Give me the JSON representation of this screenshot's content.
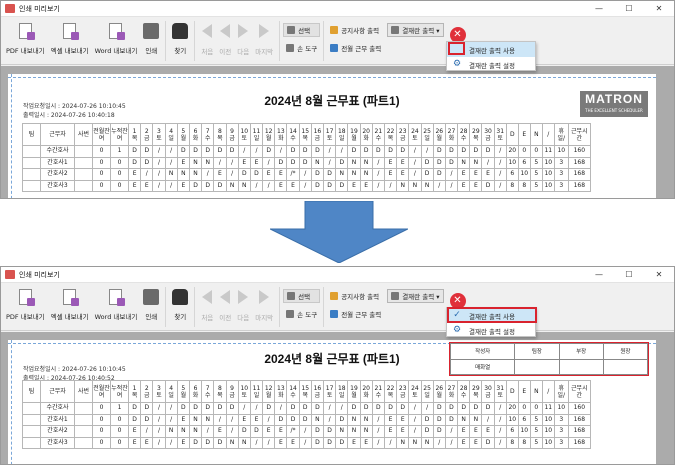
{
  "window": {
    "title": "인쇄 미리보기",
    "controls": [
      "—",
      "☐",
      "✕"
    ]
  },
  "toolbar": {
    "pdf": "PDF 내보내기",
    "excel": "엑셀 내보내기",
    "word": "Word 내보내기",
    "print": "인쇄",
    "find": "찾기",
    "first": "처음",
    "prev": "이전",
    "next": "다음",
    "last": "마지막",
    "select": "선택",
    "hand": "손 도구",
    "notice": "공지사항 출력",
    "full": "전월 근무 출력",
    "approval_dropdown": "결재란 출력 ▾"
  },
  "menu": {
    "use": "결재란 출력 사용",
    "settings": "결재란 출력 설정"
  },
  "doc_top": {
    "created": "작업요청일시 : 2024-07-26 10:10:45",
    "printed": "출력일시 : 2024-07-26 10:40:18"
  },
  "doc_bottom": {
    "created": "작업요청일시 : 2024-07-26 10:10:45",
    "printed": "출력일시 : 2024-07-26 10:40:52"
  },
  "doc_title": "2024년 8월 근무표 (파트1)",
  "logo": {
    "brand": "MATRON",
    "tagline": "THE EXCELLENT SCHEDULER"
  },
  "approval_box": {
    "row1": [
      "작성자",
      "팀장",
      "부장",
      "원장"
    ],
    "row2": [
      "매화열",
      "",
      "",
      ""
    ]
  },
  "grid": {
    "headers": [
      "팀",
      "근무자",
      "사번",
      "전월잔여",
      "누적잔여",
      "1 목",
      "2 금",
      "3 토",
      "4 일",
      "5 월",
      "6 화",
      "7 수",
      "8 목",
      "9 금",
      "10 토",
      "11 일",
      "12 월",
      "13 화",
      "14 수",
      "15 목",
      "16 금",
      "17 토",
      "18 일",
      "19 월",
      "20 화",
      "21 수",
      "22 목",
      "23 금",
      "24 토",
      "25 일",
      "26 월",
      "27 화",
      "28 수",
      "29 목",
      "30 금",
      "31 토",
      "D",
      "E",
      "N",
      "/",
      "휴일/",
      "근무시간"
    ],
    "rows": [
      [
        "",
        "수간호사",
        "",
        "0",
        "1",
        "D",
        "D",
        "/",
        "/",
        "D",
        "D",
        "D",
        "D",
        "D",
        "/",
        "/",
        "D",
        "/",
        "D",
        "D",
        "D",
        "/",
        "/",
        "D",
        "D",
        "D",
        "D",
        "D",
        "/",
        "/",
        "D",
        "D",
        "D",
        "D",
        "D",
        "/",
        "20",
        "0",
        "0",
        "11",
        "10",
        "160"
      ],
      [
        "",
        "간호사1",
        "",
        "0",
        "0",
        "D",
        "D",
        "/",
        "/",
        "E",
        "N",
        "N",
        "/",
        "/",
        "E",
        "E",
        "/",
        "D",
        "D",
        "D",
        "N",
        "/",
        "D",
        "N",
        "N",
        "/",
        "E",
        "E",
        "/",
        "D",
        "D",
        "D",
        "N",
        "N",
        "/",
        "/",
        "10",
        "6",
        "5",
        "10",
        "3",
        "168"
      ],
      [
        "",
        "간호사2",
        "",
        "0",
        "0",
        "E",
        "/",
        "/",
        "N",
        "N",
        "N",
        "/",
        "E",
        "/",
        "D",
        "D",
        "E",
        "E",
        "/*",
        "/",
        "D",
        "D",
        "N",
        "N",
        "N",
        "/",
        "E",
        "E",
        "/",
        "D",
        "D",
        "/",
        "E",
        "E",
        "E",
        "/",
        "6",
        "10",
        "5",
        "10",
        "3",
        "168"
      ],
      [
        "",
        "간호사3",
        "",
        "0",
        "0",
        "E",
        "E",
        "/",
        "/",
        "E",
        "D",
        "D",
        "D",
        "N",
        "N",
        "/",
        "/",
        "E",
        "E",
        "/",
        "D",
        "D",
        "D",
        "E",
        "E",
        "/",
        "/",
        "N",
        "N",
        "N",
        "/",
        "/",
        "E",
        "E",
        "D",
        "/",
        "8",
        "8",
        "5",
        "10",
        "3",
        "168"
      ]
    ]
  }
}
